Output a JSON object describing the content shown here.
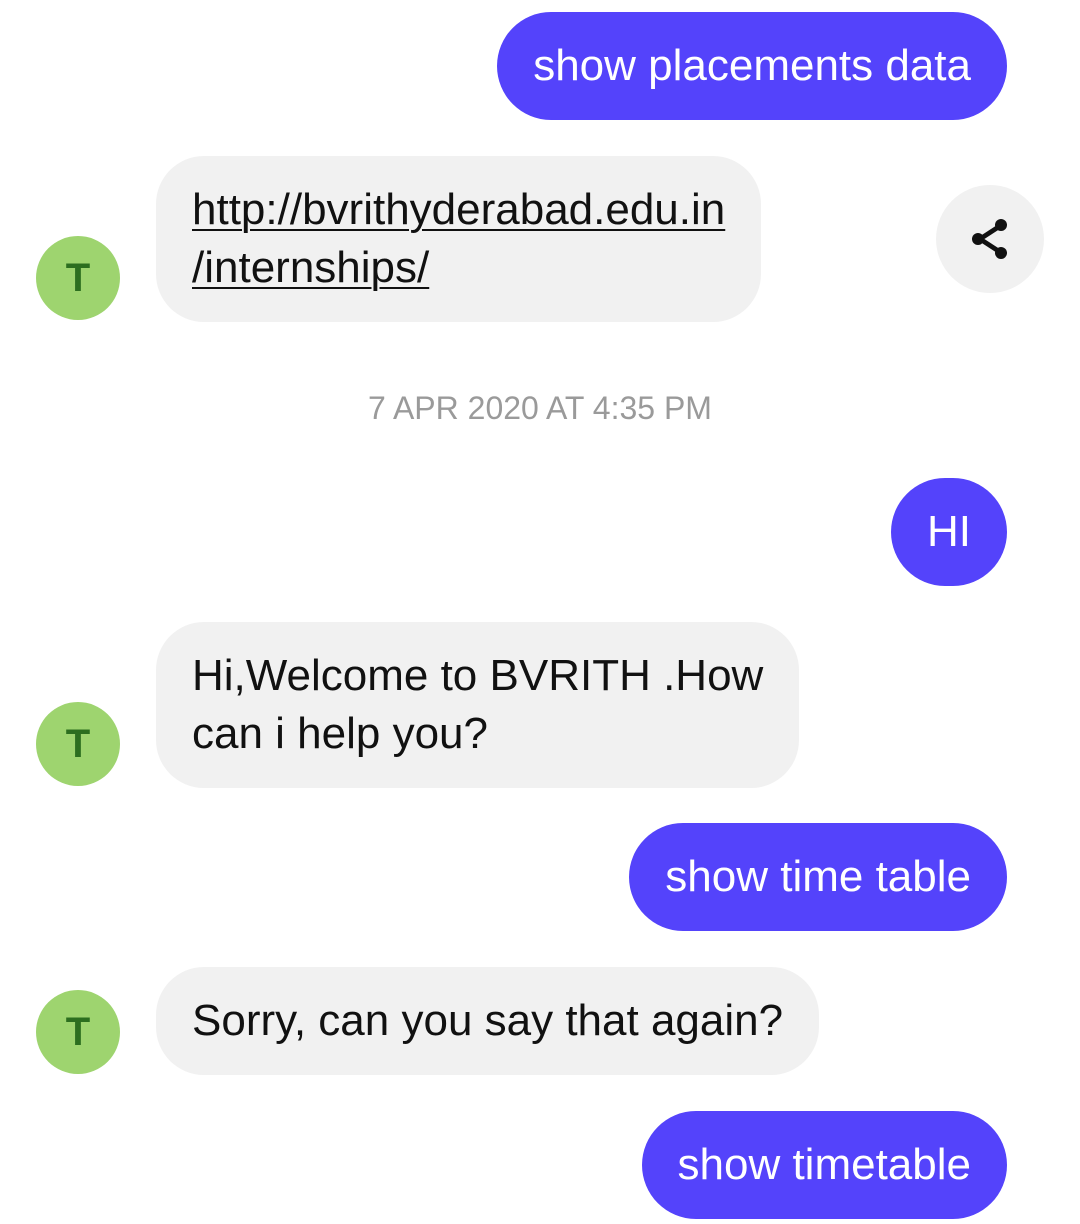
{
  "messages": [
    {
      "sender": "user",
      "text": "show placements data"
    },
    {
      "sender": "bot",
      "avatar": "T",
      "link_line1": "http://bvrithyderabad.edu.in",
      "link_line2": "/internships/"
    },
    {
      "sender": "user",
      "text": "HI"
    },
    {
      "sender": "bot",
      "avatar": "T",
      "line1": "Hi,Welcome to BVRITH .How",
      "line2": "can i help you?"
    },
    {
      "sender": "user",
      "text": "show time table"
    },
    {
      "sender": "bot",
      "avatar": "T",
      "text": "Sorry, can you say that again?"
    },
    {
      "sender": "user",
      "text": "show timetable"
    }
  ],
  "timestamp": "7 APR 2020 AT 4:35 PM",
  "icons": {
    "share": "share-icon"
  },
  "colors": {
    "user_bubble": "#5443fb",
    "bot_bubble": "#f1f1f1",
    "avatar_bg": "#9ed46f",
    "avatar_text": "#2c6e1f",
    "timestamp": "#9a9a9a"
  }
}
